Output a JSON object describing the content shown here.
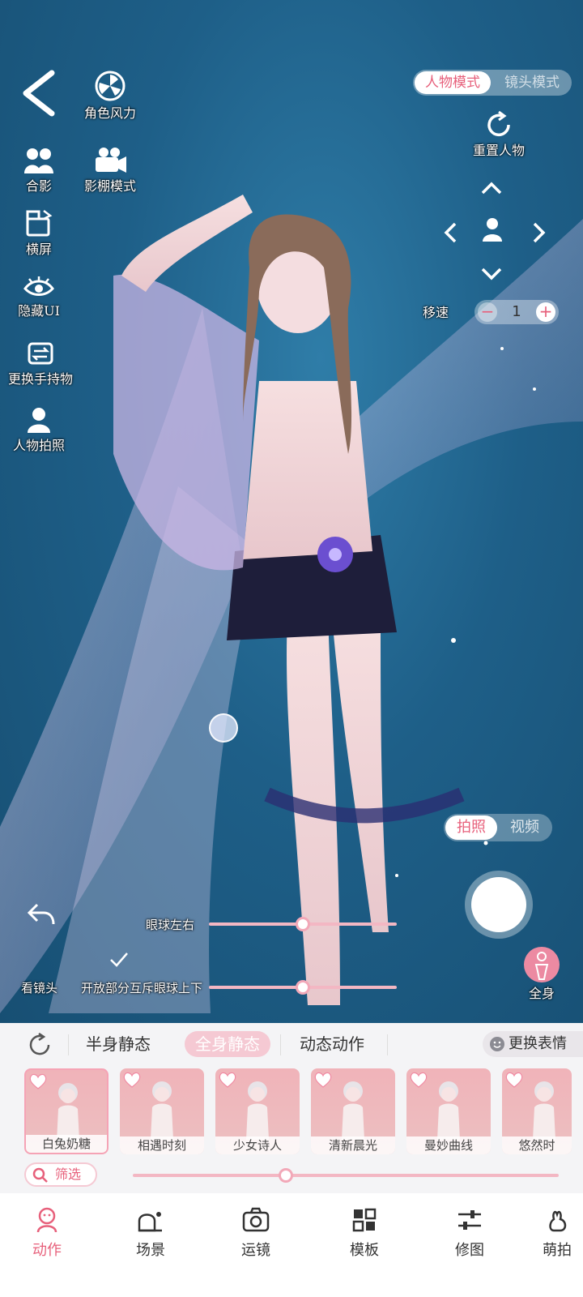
{
  "top": {
    "mode_active": "人物模式",
    "mode_inactive": "镜头模式",
    "reset_label": "重置人物",
    "speed_label": "移速",
    "speed_value": "1"
  },
  "left_tools": [
    {
      "label": "角色风力"
    },
    {
      "label": "合影"
    },
    {
      "label": "影棚模式"
    },
    {
      "label": "横屏"
    },
    {
      "label": "隐藏UI"
    },
    {
      "label": "更换手持物"
    },
    {
      "label": "人物拍照"
    }
  ],
  "capture": {
    "photo": "拍照",
    "video": "视频",
    "body": "全身"
  },
  "sliders": [
    {
      "label": "眼球左右",
      "value": 0.5
    },
    {
      "label": "眼球上下",
      "value": 0.5
    }
  ],
  "controls": {
    "look_camera": "看镜头",
    "open_partial": "开放部分互斥"
  },
  "pose_tabs": {
    "tab1": "半身静态",
    "tab2": "全身静态",
    "tab3": "动态动作",
    "change_expr": "更换表情"
  },
  "poses": [
    "白兔奶糖",
    "相遇时刻",
    "少女诗人",
    "清新晨光",
    "曼妙曲线",
    "悠然时"
  ],
  "filter_label": "筛选",
  "filter_slider": 0.36,
  "bottom_nav": [
    "动作",
    "场景",
    "运镜",
    "模板",
    "修图",
    "萌拍"
  ],
  "colors": {
    "accent": "#e7607b",
    "pink_soft": "#f3b7c3"
  }
}
